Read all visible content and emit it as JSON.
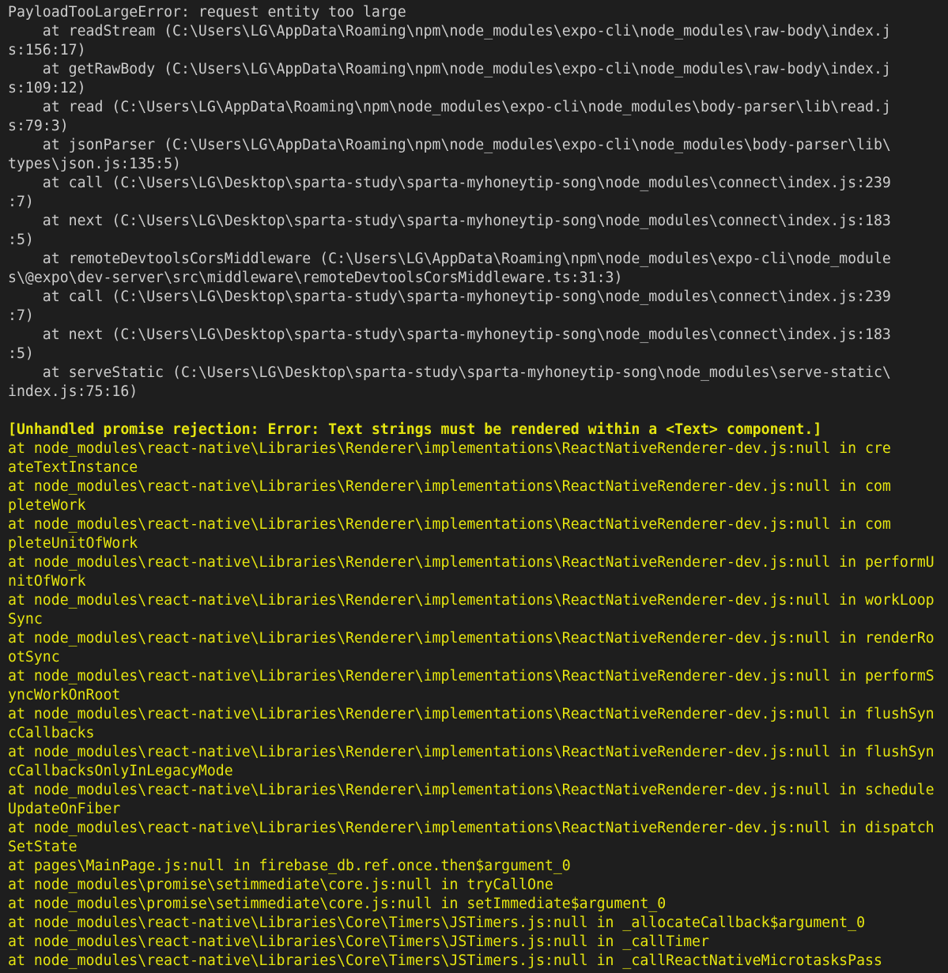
{
  "terminal": {
    "colors": {
      "background": "#1e1e1e",
      "default_text": "#cccccc",
      "warning_text": "#e5e510"
    },
    "lines": [
      {
        "text": "PayloadTooLargeError: request entity too large",
        "color": "gray",
        "bold": false
      },
      {
        "text": "    at readStream (C:\\Users\\LG\\AppData\\Roaming\\npm\\node_modules\\expo-cli\\node_modules\\raw-body\\index.j",
        "color": "gray",
        "bold": false
      },
      {
        "text": "s:156:17)",
        "color": "gray",
        "bold": false
      },
      {
        "text": "    at getRawBody (C:\\Users\\LG\\AppData\\Roaming\\npm\\node_modules\\expo-cli\\node_modules\\raw-body\\index.j",
        "color": "gray",
        "bold": false
      },
      {
        "text": "s:109:12)",
        "color": "gray",
        "bold": false
      },
      {
        "text": "    at read (C:\\Users\\LG\\AppData\\Roaming\\npm\\node_modules\\expo-cli\\node_modules\\body-parser\\lib\\read.j",
        "color": "gray",
        "bold": false
      },
      {
        "text": "s:79:3)",
        "color": "gray",
        "bold": false
      },
      {
        "text": "    at jsonParser (C:\\Users\\LG\\AppData\\Roaming\\npm\\node_modules\\expo-cli\\node_modules\\body-parser\\lib\\",
        "color": "gray",
        "bold": false
      },
      {
        "text": "types\\json.js:135:5)",
        "color": "gray",
        "bold": false
      },
      {
        "text": "    at call (C:\\Users\\LG\\Desktop\\sparta-study\\sparta-myhoneytip-song\\node_modules\\connect\\index.js:239",
        "color": "gray",
        "bold": false
      },
      {
        "text": ":7)",
        "color": "gray",
        "bold": false
      },
      {
        "text": "    at next (C:\\Users\\LG\\Desktop\\sparta-study\\sparta-myhoneytip-song\\node_modules\\connect\\index.js:183",
        "color": "gray",
        "bold": false
      },
      {
        "text": ":5)",
        "color": "gray",
        "bold": false
      },
      {
        "text": "    at remoteDevtoolsCorsMiddleware (C:\\Users\\LG\\AppData\\Roaming\\npm\\node_modules\\expo-cli\\node_module",
        "color": "gray",
        "bold": false
      },
      {
        "text": "s\\@expo\\dev-server\\src\\middleware\\remoteDevtoolsCorsMiddleware.ts:31:3)",
        "color": "gray",
        "bold": false
      },
      {
        "text": "    at call (C:\\Users\\LG\\Desktop\\sparta-study\\sparta-myhoneytip-song\\node_modules\\connect\\index.js:239",
        "color": "gray",
        "bold": false
      },
      {
        "text": ":7)",
        "color": "gray",
        "bold": false
      },
      {
        "text": "    at next (C:\\Users\\LG\\Desktop\\sparta-study\\sparta-myhoneytip-song\\node_modules\\connect\\index.js:183",
        "color": "gray",
        "bold": false
      },
      {
        "text": ":5)",
        "color": "gray",
        "bold": false
      },
      {
        "text": "    at serveStatic (C:\\Users\\LG\\Desktop\\sparta-study\\sparta-myhoneytip-song\\node_modules\\serve-static\\",
        "color": "gray",
        "bold": false
      },
      {
        "text": "index.js:75:16)",
        "color": "gray",
        "bold": false
      },
      {
        "text": "",
        "color": "gray",
        "bold": false
      },
      {
        "text": "[Unhandled promise rejection: Error: Text strings must be rendered within a <Text> component.]",
        "color": "yellow",
        "bold": true
      },
      {
        "text": "at node_modules\\react-native\\Libraries\\Renderer\\implementations\\ReactNativeRenderer-dev.js:null in cre",
        "color": "yellow",
        "bold": false
      },
      {
        "text": "ateTextInstance",
        "color": "yellow",
        "bold": false
      },
      {
        "text": "at node_modules\\react-native\\Libraries\\Renderer\\implementations\\ReactNativeRenderer-dev.js:null in com",
        "color": "yellow",
        "bold": false
      },
      {
        "text": "pleteWork",
        "color": "yellow",
        "bold": false
      },
      {
        "text": "at node_modules\\react-native\\Libraries\\Renderer\\implementations\\ReactNativeRenderer-dev.js:null in com",
        "color": "yellow",
        "bold": false
      },
      {
        "text": "pleteUnitOfWork",
        "color": "yellow",
        "bold": false
      },
      {
        "text": "at node_modules\\react-native\\Libraries\\Renderer\\implementations\\ReactNativeRenderer-dev.js:null in performU",
        "color": "yellow",
        "bold": false
      },
      {
        "text": "nitOfWork",
        "color": "yellow",
        "bold": false
      },
      {
        "text": "at node_modules\\react-native\\Libraries\\Renderer\\implementations\\ReactNativeRenderer-dev.js:null in workLoop",
        "color": "yellow",
        "bold": false
      },
      {
        "text": "Sync",
        "color": "yellow",
        "bold": false
      },
      {
        "text": "at node_modules\\react-native\\Libraries\\Renderer\\implementations\\ReactNativeRenderer-dev.js:null in renderRo",
        "color": "yellow",
        "bold": false
      },
      {
        "text": "otSync",
        "color": "yellow",
        "bold": false
      },
      {
        "text": "at node_modules\\react-native\\Libraries\\Renderer\\implementations\\ReactNativeRenderer-dev.js:null in performS",
        "color": "yellow",
        "bold": false
      },
      {
        "text": "yncWorkOnRoot",
        "color": "yellow",
        "bold": false
      },
      {
        "text": "at node_modules\\react-native\\Libraries\\Renderer\\implementations\\ReactNativeRenderer-dev.js:null in flushSyn",
        "color": "yellow",
        "bold": false
      },
      {
        "text": "cCallbacks",
        "color": "yellow",
        "bold": false
      },
      {
        "text": "at node_modules\\react-native\\Libraries\\Renderer\\implementations\\ReactNativeRenderer-dev.js:null in flushSyn",
        "color": "yellow",
        "bold": false
      },
      {
        "text": "cCallbacksOnlyInLegacyMode",
        "color": "yellow",
        "bold": false
      },
      {
        "text": "at node_modules\\react-native\\Libraries\\Renderer\\implementations\\ReactNativeRenderer-dev.js:null in schedule",
        "color": "yellow",
        "bold": false
      },
      {
        "text": "UpdateOnFiber",
        "color": "yellow",
        "bold": false
      },
      {
        "text": "at node_modules\\react-native\\Libraries\\Renderer\\implementations\\ReactNativeRenderer-dev.js:null in dispatch",
        "color": "yellow",
        "bold": false
      },
      {
        "text": "SetState",
        "color": "yellow",
        "bold": false
      },
      {
        "text": "at pages\\MainPage.js:null in firebase_db.ref.once.then$argument_0",
        "color": "yellow",
        "bold": false
      },
      {
        "text": "at node_modules\\promise\\setimmediate\\core.js:null in tryCallOne",
        "color": "yellow",
        "bold": false
      },
      {
        "text": "at node_modules\\promise\\setimmediate\\core.js:null in setImmediate$argument_0",
        "color": "yellow",
        "bold": false
      },
      {
        "text": "at node_modules\\react-native\\Libraries\\Core\\Timers\\JSTimers.js:null in _allocateCallback$argument_0",
        "color": "yellow",
        "bold": false
      },
      {
        "text": "at node_modules\\react-native\\Libraries\\Core\\Timers\\JSTimers.js:null in _callTimer",
        "color": "yellow",
        "bold": false
      },
      {
        "text": "at node_modules\\react-native\\Libraries\\Core\\Timers\\JSTimers.js:null in _callReactNativeMicrotasksPass",
        "color": "yellow",
        "bold": false
      }
    ]
  }
}
